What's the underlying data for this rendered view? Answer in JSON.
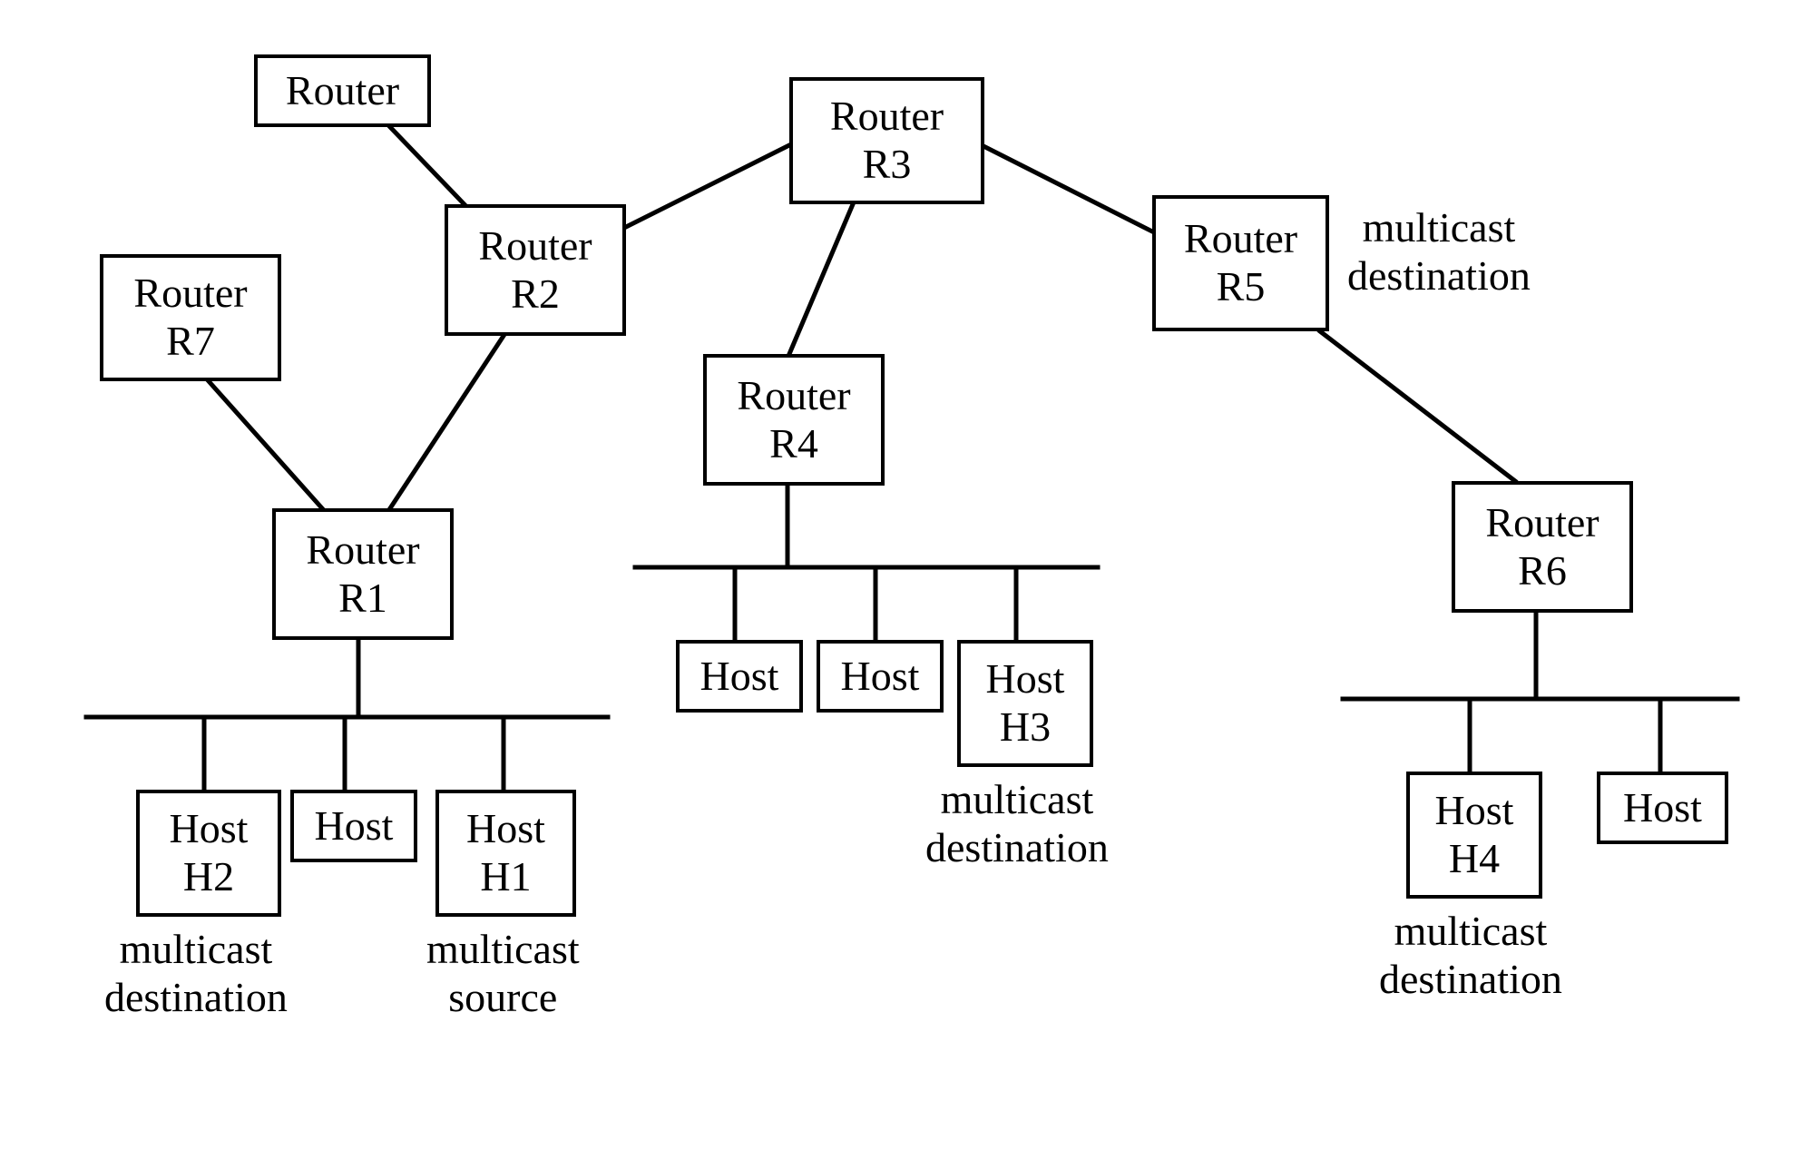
{
  "nodes": {
    "router_top": {
      "line1": "Router",
      "line2": ""
    },
    "router_r2": {
      "line1": "Router",
      "line2": "R2"
    },
    "router_r3": {
      "line1": "Router",
      "line2": "R3"
    },
    "router_r5": {
      "line1": "Router",
      "line2": "R5"
    },
    "router_r7": {
      "line1": "Router",
      "line2": "R7"
    },
    "router_r1": {
      "line1": "Router",
      "line2": "R1"
    },
    "router_r4": {
      "line1": "Router",
      "line2": "R4"
    },
    "router_r6": {
      "line1": "Router",
      "line2": "R6"
    },
    "host_h2": {
      "line1": "Host",
      "line2": "H2"
    },
    "host_a": {
      "line1": "Host",
      "line2": ""
    },
    "host_h1": {
      "line1": "Host",
      "line2": "H1"
    },
    "host_b": {
      "line1": "Host",
      "line2": ""
    },
    "host_c": {
      "line1": "Host",
      "line2": ""
    },
    "host_h3": {
      "line1": "Host",
      "line2": "H3"
    },
    "host_h4": {
      "line1": "Host",
      "line2": "H4"
    },
    "host_d": {
      "line1": "Host",
      "line2": ""
    }
  },
  "annotations": {
    "r5_annot": "multicast\ndestination",
    "h2_annot": "multicast\ndestination",
    "h1_annot": "multicast\nsource",
    "h3_annot": "multicast\ndestination",
    "h4_annot": "multicast\ndestination"
  },
  "chart_data": {
    "type": "network_diagram",
    "nodes": [
      {
        "id": "router_top",
        "kind": "router",
        "label": "Router"
      },
      {
        "id": "R2",
        "kind": "router",
        "label": "Router R2"
      },
      {
        "id": "R3",
        "kind": "router",
        "label": "Router R3"
      },
      {
        "id": "R5",
        "kind": "router",
        "label": "Router R5",
        "role": "multicast destination"
      },
      {
        "id": "R7",
        "kind": "router",
        "label": "Router R7"
      },
      {
        "id": "R1",
        "kind": "router",
        "label": "Router R1"
      },
      {
        "id": "R4",
        "kind": "router",
        "label": "Router R4"
      },
      {
        "id": "R6",
        "kind": "router",
        "label": "Router R6"
      },
      {
        "id": "H2",
        "kind": "host",
        "label": "Host H2",
        "role": "multicast destination"
      },
      {
        "id": "host_a",
        "kind": "host",
        "label": "Host"
      },
      {
        "id": "H1",
        "kind": "host",
        "label": "Host H1",
        "role": "multicast source"
      },
      {
        "id": "host_b",
        "kind": "host",
        "label": "Host"
      },
      {
        "id": "host_c",
        "kind": "host",
        "label": "Host"
      },
      {
        "id": "H3",
        "kind": "host",
        "label": "Host H3",
        "role": "multicast destination"
      },
      {
        "id": "H4",
        "kind": "host",
        "label": "Host H4",
        "role": "multicast destination"
      },
      {
        "id": "host_d",
        "kind": "host",
        "label": "Host"
      }
    ],
    "edges": [
      [
        "router_top",
        "R2"
      ],
      [
        "R2",
        "R3"
      ],
      [
        "R3",
        "R5"
      ],
      [
        "R2",
        "R1"
      ],
      [
        "R7",
        "R1"
      ],
      [
        "R3",
        "R4"
      ],
      [
        "R5",
        "R6"
      ],
      [
        "R1",
        "LAN1"
      ],
      [
        "R4",
        "LAN2"
      ],
      [
        "R6",
        "LAN3"
      ],
      [
        "LAN1",
        "H2"
      ],
      [
        "LAN1",
        "host_a"
      ],
      [
        "LAN1",
        "H1"
      ],
      [
        "LAN2",
        "host_b"
      ],
      [
        "LAN2",
        "host_c"
      ],
      [
        "LAN2",
        "H3"
      ],
      [
        "LAN3",
        "H4"
      ],
      [
        "LAN3",
        "host_d"
      ]
    ],
    "lans": [
      "LAN1",
      "LAN2",
      "LAN3"
    ]
  }
}
